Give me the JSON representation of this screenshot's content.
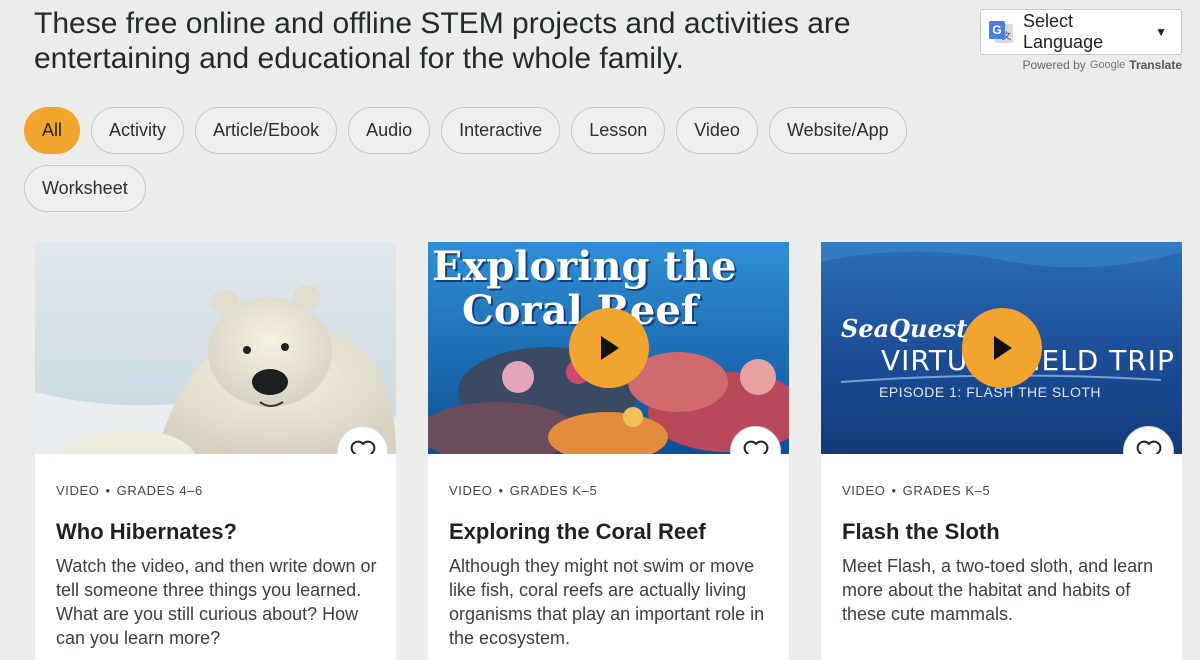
{
  "header": {
    "intro": "These free online and offline STEM projects and activities are entertaining and educational for the whole family.",
    "language_select": "Select Language",
    "powered_by": "Powered by",
    "google": "Google",
    "translate": "Translate"
  },
  "filters": [
    {
      "label": "All",
      "active": true
    },
    {
      "label": "Activity"
    },
    {
      "label": "Article/Ebook"
    },
    {
      "label": "Audio"
    },
    {
      "label": "Interactive"
    },
    {
      "label": "Lesson"
    },
    {
      "label": "Video"
    },
    {
      "label": "Website/App"
    },
    {
      "label": "Worksheet"
    }
  ],
  "cards": [
    {
      "type": "VIDEO",
      "grades": "GRADES 4–6",
      "title": "Who Hibernates?",
      "description": "Watch the video, and then write down or tell someone three things you learned. What are you still curious about? How can you learn more?",
      "image": "polar-bear"
    },
    {
      "type": "VIDEO",
      "grades": "GRADES K–5",
      "title": "Exploring the Coral Reef",
      "description": "Although they might not swim or move like fish, coral reefs are actually living organisms that play an important role in the ecosystem.",
      "image": "coral-reef",
      "overlay_line1": "Exploring the",
      "overlay_line2": "Coral Reef"
    },
    {
      "type": "VIDEO",
      "grades": "GRADES K–5",
      "title": "Flash the Sloth",
      "description": "Meet Flash, a two-toed sloth, and learn more about the habitat and habits of these cute mammals.",
      "image": "underwater",
      "overlay_brand": "SeaQuest",
      "overlay_line1": "VIRTUAL FIELD TRIP",
      "overlay_line2": "EPISODE 1: FLASH THE SLOTH"
    }
  ],
  "colors": {
    "accent": "#f2a52e",
    "background": "#ececeb"
  },
  "icons": {
    "play": "play-icon",
    "favorite": "heart-outline-icon",
    "dropdown": "caret-down-icon"
  }
}
